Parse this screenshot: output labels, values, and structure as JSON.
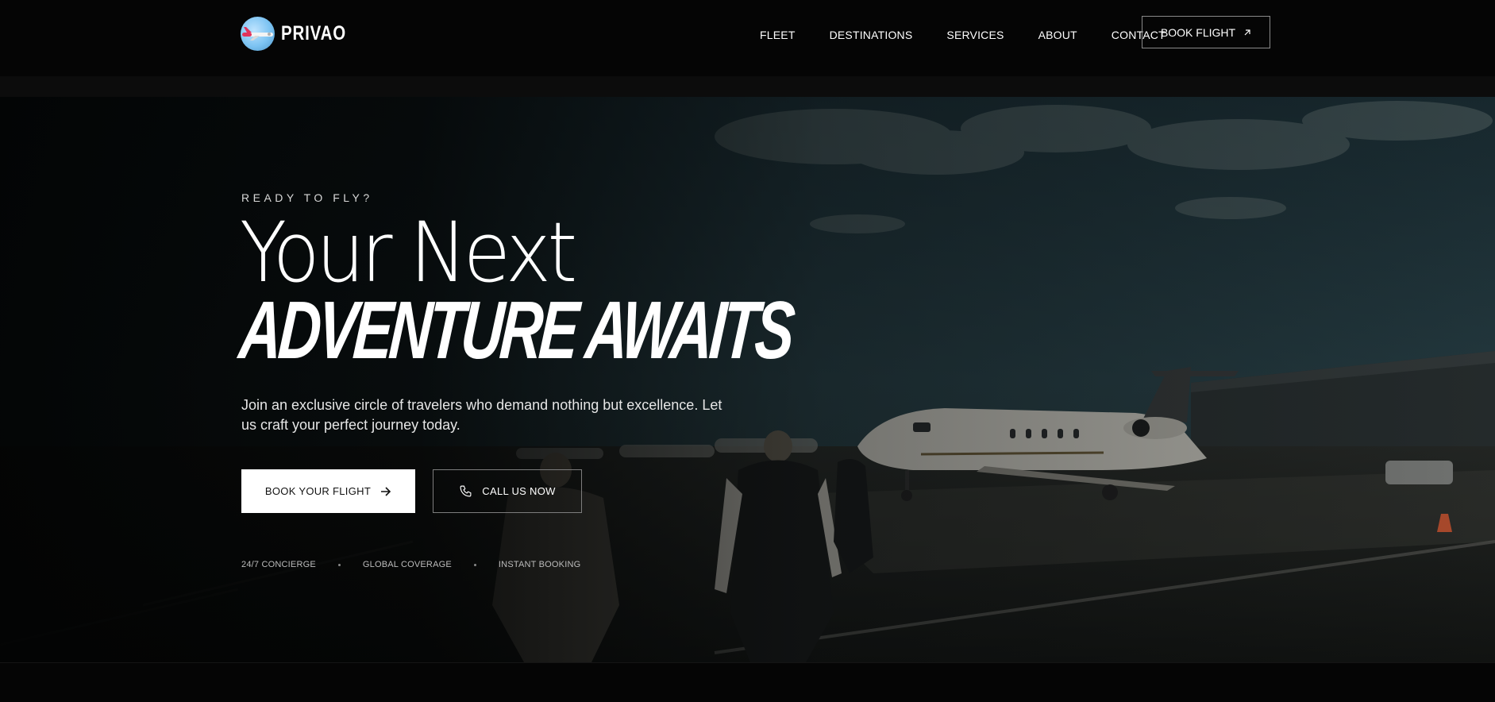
{
  "brand": {
    "name": "PRIVAO",
    "logo_icon": "jet-logo-icon"
  },
  "nav": {
    "items": [
      {
        "label": "FLEET"
      },
      {
        "label": "DESTINATIONS"
      },
      {
        "label": "SERVICES"
      },
      {
        "label": "ABOUT"
      },
      {
        "label": "CONTACT"
      }
    ],
    "book_button": "BOOK FLIGHT",
    "book_icon": "arrow-up-right-icon"
  },
  "hero": {
    "eyebrow": "READY TO FLY?",
    "title_line1": "Your Next",
    "title_line2": "ADVENTURE AWAITS",
    "description": "Join an exclusive circle of travelers who demand nothing but excellence. Let us craft your perfect journey today.",
    "primary_cta": "BOOK YOUR FLIGHT",
    "primary_icon": "arrow-right-icon",
    "secondary_cta": "CALL US NOW",
    "secondary_icon": "phone-icon",
    "features": [
      "24/7 CONCIERGE",
      "GLOBAL COVERAGE",
      "INSTANT BOOKING"
    ],
    "background": "private-jet-tarmac-photo"
  },
  "colors": {
    "background": "#050505",
    "text": "#ffffff",
    "primary_button_bg": "#ffffff",
    "primary_button_text": "#111111"
  }
}
